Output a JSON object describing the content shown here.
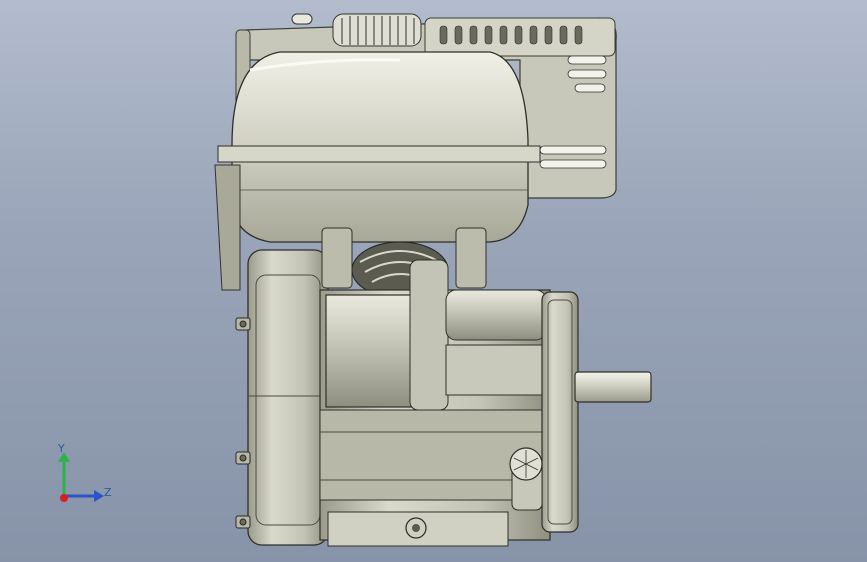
{
  "triad": {
    "y_label": "Y",
    "z_label": "Z",
    "colors": {
      "y": "#2db34a",
      "z": "#2a55c8",
      "x": "#d42020"
    }
  },
  "model": {
    "name_icon": "engine-3d-model",
    "shade_colors": {
      "body": "#c9c9ba",
      "dark": "#3f3f37",
      "light": "#e6e6da"
    }
  }
}
